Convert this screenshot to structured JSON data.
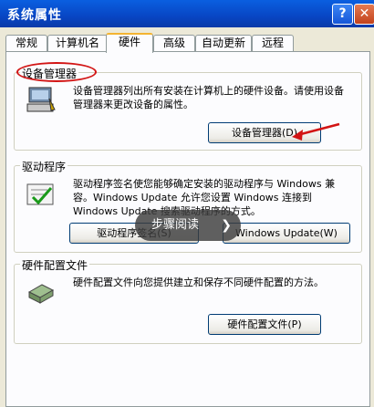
{
  "window": {
    "title": "系统属性",
    "help_label": "?",
    "close_label": "✕"
  },
  "tabs": [
    {
      "label": "常规"
    },
    {
      "label": "计算机名"
    },
    {
      "label": "硬件"
    },
    {
      "label": "高级"
    },
    {
      "label": "自动更新"
    },
    {
      "label": "远程"
    }
  ],
  "device_manager": {
    "title": "设备管理器",
    "description": "设备管理器列出所有安装在计算机上的硬件设备。请使用设备管理器来更改设备的属性。",
    "button": "设备管理器(D)"
  },
  "drivers": {
    "title": "驱动程序",
    "description": "驱动程序签名使您能够确定安装的驱动程序与 Windows 兼容。Windows Update 允许您设置 Windows 连接到 Windows Update 搜索驱动程序的方式。",
    "button_signing": "驱动程序签名(S)",
    "button_update": "Windows Update(W)"
  },
  "hardware_profiles": {
    "title": "硬件配置文件",
    "description": "硬件配置文件向您提供建立和保存不同硬件配置的方法。",
    "button": "硬件配置文件(P)"
  },
  "overlay": {
    "label": "步骤阅读",
    "chevron": "❯"
  },
  "colors": {
    "title_bar": "#0846c4",
    "annotation": "#d21414",
    "face": "#ece9d8"
  }
}
